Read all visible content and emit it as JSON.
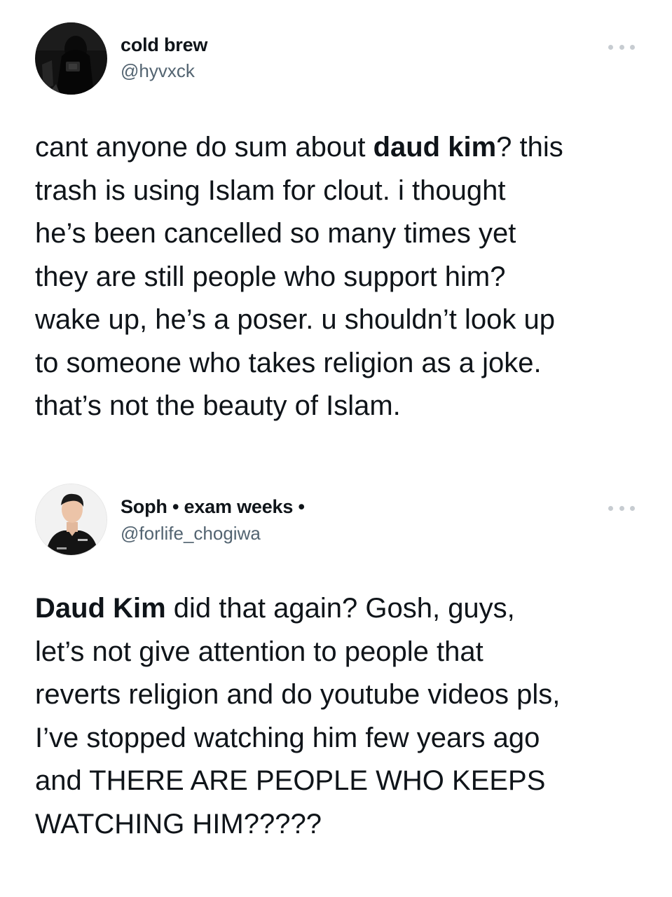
{
  "tweets": [
    {
      "display_name": "cold brew",
      "handle": "@hyvxck",
      "avatar_icon": "profile-photo-dark-silhouette",
      "more_icon": "more-options-icon",
      "lines": [
        {
          "a": "cant anyone do sum about ",
          "b": "daud kim",
          "c": "? this"
        },
        {
          "a": "trash is using Islam for clout. i thought"
        },
        {
          "a": "he’s been cancelled so many times yet"
        },
        {
          "a": "they are still people who support him?"
        },
        {
          "a": "wake up, he’s a poser. u shouldn’t look up"
        },
        {
          "a": "to someone who takes religion as a joke."
        },
        {
          "a": "that’s not the beauty of Islam."
        }
      ]
    },
    {
      "display_name": "Soph • exam weeks •",
      "handle": "@forlife_chogiwa",
      "avatar_icon": "profile-photo-man-black-shirt",
      "more_icon": "more-options-icon",
      "lines": [
        {
          "b": "Daud Kim",
          "c": " did that again? Gosh, guys,"
        },
        {
          "a": "let’s not give attention to people that"
        },
        {
          "a": "reverts religion and do youtube videos pls,"
        },
        {
          "a": "I’ve stopped watching him few years ago"
        },
        {
          "a": "and THERE ARE PEOPLE WHO KEEPS"
        },
        {
          "a": "WATCHING HIM?????"
        }
      ]
    }
  ],
  "colors": {
    "text": "#0f1419",
    "secondary": "#536471",
    "more_dots": "#c7ccd1",
    "background": "#ffffff"
  }
}
